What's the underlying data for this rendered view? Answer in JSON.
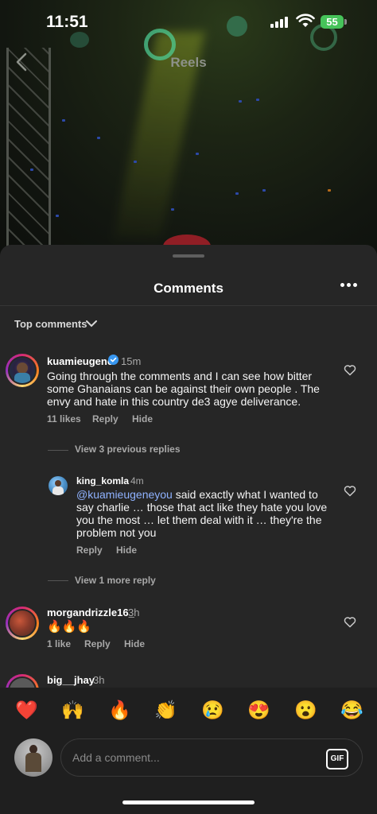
{
  "status": {
    "time": "11:51",
    "battery": "55"
  },
  "header": {
    "title": "Reels"
  },
  "sheet": {
    "title": "Comments",
    "sort_label": "Top comments"
  },
  "comments": [
    {
      "username": "kuamieugene",
      "verified": true,
      "time": "15m",
      "text": "Going through the comments and I can see how bitter some Ghanaians can be against their own people . The envy and hate in this country de3 agye deliverance.",
      "likes": "11 likes",
      "reply": "Reply",
      "hide": "Hide",
      "view_replies": "View 3 previous replies",
      "replies": [
        {
          "username": "king_komla",
          "time": "4m",
          "mention": "@kuamieugeneyou",
          "text": " said exactly what I wanted to say charlie … those that act like they hate you love you the most … let them deal with it … they're the problem not you",
          "reply": "Reply",
          "hide": "Hide"
        }
      ],
      "view_more": "View 1 more reply"
    },
    {
      "username": "morgandrizzle16_",
      "time": "3h",
      "text": "🔥🔥🔥",
      "likes": "1 like",
      "reply": "Reply",
      "hide": "Hide"
    },
    {
      "username": "big__jhay",
      "time": "3h"
    }
  ],
  "reactions": [
    "❤️",
    "🙌",
    "🔥",
    "👏",
    "😢",
    "😍",
    "😮",
    "😂"
  ],
  "composer": {
    "placeholder": "Add a comment...",
    "gif_label": "GIF"
  },
  "colors": {
    "sheet": "#262626",
    "mention": "#8fb2ff",
    "battery": "#46c35a"
  }
}
